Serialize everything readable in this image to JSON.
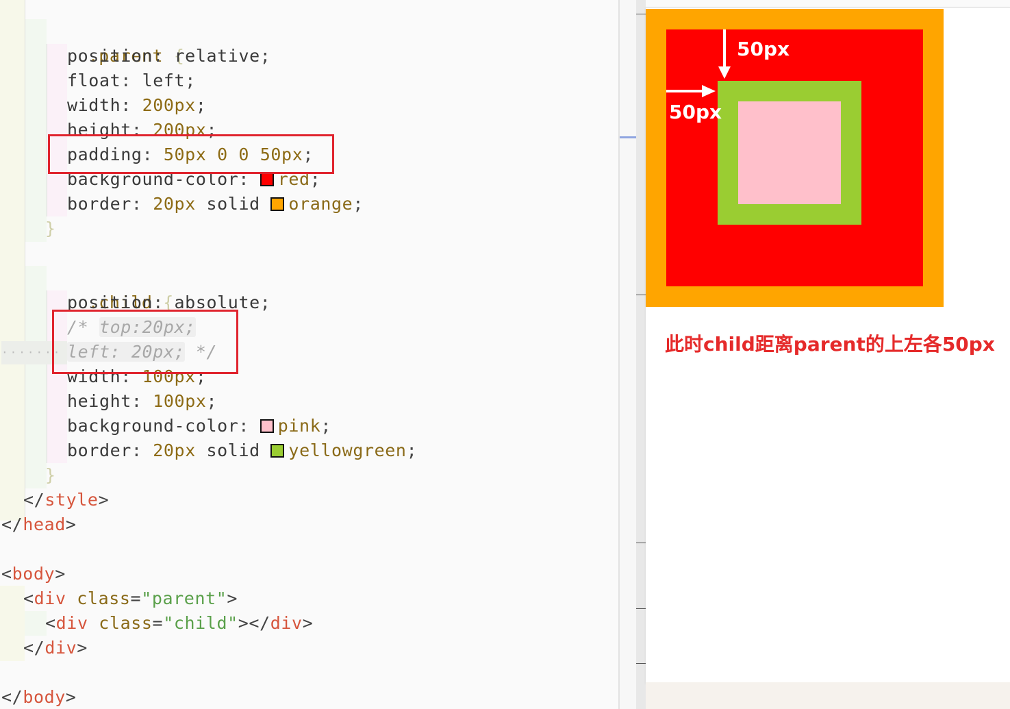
{
  "editor": {
    "parent_rule": {
      "selector": ".parent",
      "open": "{",
      "close": "}",
      "decls": [
        {
          "prop": "position",
          "value": "relative"
        },
        {
          "prop": "float",
          "value": "left"
        },
        {
          "prop": "width",
          "value": "200px"
        },
        {
          "prop": "height",
          "value": "200px"
        },
        {
          "prop": "padding",
          "value": "50px 0 0 50px"
        },
        {
          "prop": "background-color",
          "value": "red"
        },
        {
          "prop": "border",
          "value_num": "20px",
          "value_word": "solid",
          "value_color": "orange"
        }
      ]
    },
    "child_rule": {
      "selector": ".child",
      "open": "{",
      "close": "}",
      "decls": [
        {
          "prop": "position",
          "value": "absolute"
        },
        {
          "comment_1": "/*",
          "comment_1b": "top:20px;"
        },
        {
          "comment_2": "left: 20px;",
          "comment_2b": "*/"
        },
        {
          "prop": "width",
          "value": "100px"
        },
        {
          "prop": "height",
          "value": "100px"
        },
        {
          "prop": "background-color",
          "value": "pink"
        },
        {
          "prop": "border",
          "value_num": "20px",
          "value_word": "solid",
          "value_color": "yellowgreen"
        }
      ]
    },
    "tags": {
      "style": "style",
      "head": "head",
      "body": "body",
      "div": "div",
      "class_attr": "class",
      "parent_class": "\"parent\"",
      "child_class": "\"child\""
    },
    "colors": {
      "red": "#ff0000",
      "orange": "#ffa500",
      "pink": "#ffc0cb",
      "yellowgreen": "#9acd32",
      "highlight_box": "#e0242e"
    }
  },
  "preview": {
    "top_label": "50px",
    "left_label": "50px",
    "caption": "此时child距离parent的上左各50px"
  }
}
